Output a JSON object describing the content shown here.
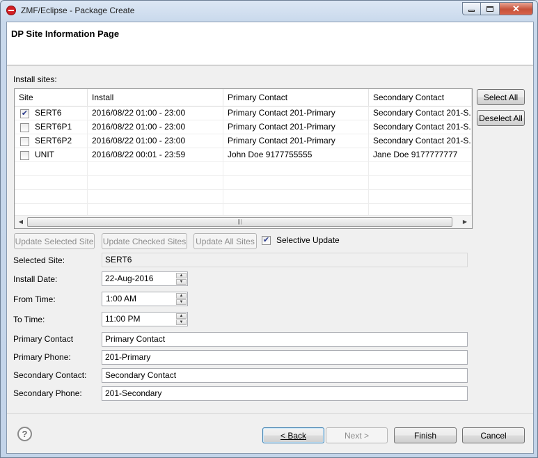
{
  "window": {
    "title": "ZMF/Eclipse - Package Create"
  },
  "header": {
    "title": "DP Site Information Page"
  },
  "install_sites": {
    "label": "Install sites:",
    "columns": [
      "Site",
      "Install",
      "Primary Contact",
      "Secondary Contact"
    ],
    "rows": [
      {
        "checked": true,
        "site": "SERT6",
        "install": "2016/08/22 01:00 - 23:00",
        "primary": "Primary Contact 201-Primary",
        "secondary": "Secondary Contact 201-S..."
      },
      {
        "checked": false,
        "site": "SERT6P1",
        "install": "2016/08/22 01:00 - 23:00",
        "primary": "Primary Contact 201-Primary",
        "secondary": "Secondary Contact 201-S..."
      },
      {
        "checked": false,
        "site": "SERT6P2",
        "install": "2016/08/22 01:00 - 23:00",
        "primary": "Primary Contact 201-Primary",
        "secondary": "Secondary Contact 201-S..."
      },
      {
        "checked": false,
        "site": "UNIT",
        "install": "2016/08/22 00:01 - 23:59",
        "primary": "John Doe 9177755555",
        "secondary": "Jane Doe 9177777777"
      }
    ],
    "select_all": "Select All",
    "deselect_all": "Deselect All"
  },
  "actions": {
    "update_selected": "Update Selected Site",
    "update_checked": "Update Checked Sites",
    "update_all": "Update All Sites",
    "selective_update": {
      "label": "Selective Update",
      "checked": true
    }
  },
  "form": {
    "selected_site": {
      "label": "Selected Site:",
      "value": "SERT6"
    },
    "install_date": {
      "label": "Install Date:",
      "value": "22-Aug-2016"
    },
    "from_time": {
      "label": "From Time:",
      "value": "1:00 AM"
    },
    "to_time": {
      "label": "To Time:",
      "value": "11:00 PM"
    },
    "primary_contact": {
      "label": "Primary Contact",
      "value": "Primary Contact"
    },
    "primary_phone": {
      "label": "Primary Phone:",
      "value": "201-Primary"
    },
    "secondary_contact": {
      "label": "Secondary Contact:",
      "value": "Secondary Contact"
    },
    "secondary_phone": {
      "label": "Secondary Phone:",
      "value": "201-Secondary"
    }
  },
  "footer": {
    "help_icon": "?",
    "back": "< Back",
    "next": "Next >",
    "finish": "Finish",
    "cancel": "Cancel"
  }
}
